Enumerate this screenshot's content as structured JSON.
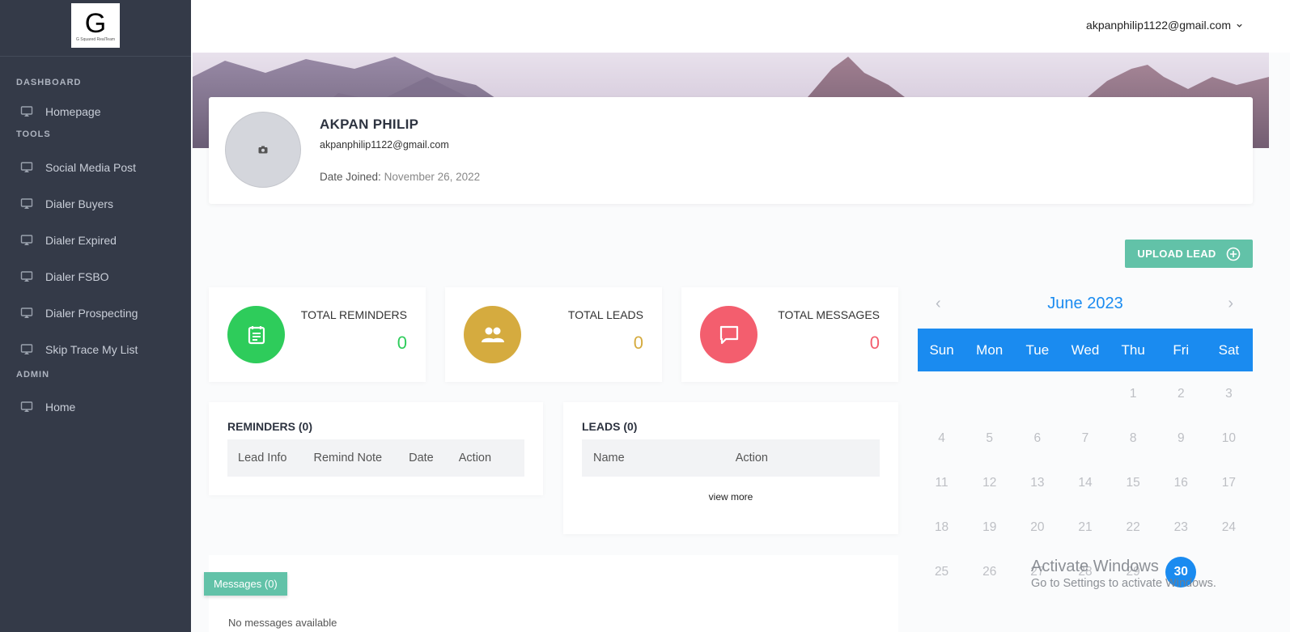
{
  "sidebar": {
    "logo_letter": "G",
    "logo_text": "G Squared RealTeam",
    "sections": {
      "dashboard": "DASHBOARD",
      "tools": "TOOLS",
      "admin": "ADMIN"
    },
    "items": {
      "homepage": "Homepage",
      "social": "Social Media Post",
      "buyers": "Dialer Buyers",
      "expired": "Dialer Expired",
      "fsbo": "Dialer FSBO",
      "prospecting": "Dialer Prospecting",
      "skiptrace": "Skip Trace My List",
      "home": "Home"
    }
  },
  "header": {
    "user_email": "akpanphilip1122@gmail.com"
  },
  "profile": {
    "name": "AKPAN PHILIP",
    "email": "akpanphilip1122@gmail.com",
    "joined_label": "Date Joined:",
    "joined_value": "November 26, 2022"
  },
  "upload_button": "UPLOAD LEAD",
  "stats": {
    "reminders": {
      "label": "TOTAL REMINDERS",
      "value": "0",
      "color": "#2ecc5b"
    },
    "leads": {
      "label": "TOTAL LEADS",
      "value": "0",
      "color": "#d5ab3f"
    },
    "messages": {
      "label": "TOTAL MESSAGES",
      "value": "0",
      "color": "#f35e6e"
    }
  },
  "reminders_panel": {
    "title": "REMINDERS (0)",
    "columns": [
      "Lead Info",
      "Remind Note",
      "Date",
      "Action"
    ]
  },
  "leads_panel": {
    "title": "LEADS (0)",
    "columns": [
      "Name",
      "Action"
    ],
    "view_more": "view more"
  },
  "messages_panel": {
    "tag": "Messages (0)",
    "empty_text": "No messages available"
  },
  "calendar": {
    "title": "June 2023",
    "prev": "‹",
    "next": "›",
    "weekdays": [
      "Sun",
      "Mon",
      "Tue",
      "Wed",
      "Thu",
      "Fri",
      "Sat"
    ],
    "rows": [
      [
        "",
        "",
        "",
        "",
        "1",
        "2",
        "3"
      ],
      [
        "4",
        "5",
        "6",
        "7",
        "8",
        "9",
        "10"
      ],
      [
        "11",
        "12",
        "13",
        "14",
        "15",
        "16",
        "17"
      ],
      [
        "18",
        "19",
        "20",
        "21",
        "22",
        "23",
        "24"
      ],
      [
        "25",
        "26",
        "27",
        "28",
        "29",
        "30",
        ""
      ]
    ],
    "today": "30"
  },
  "watermark": {
    "line1": "Activate Windows",
    "line2": "Go to Settings to activate Windows."
  }
}
